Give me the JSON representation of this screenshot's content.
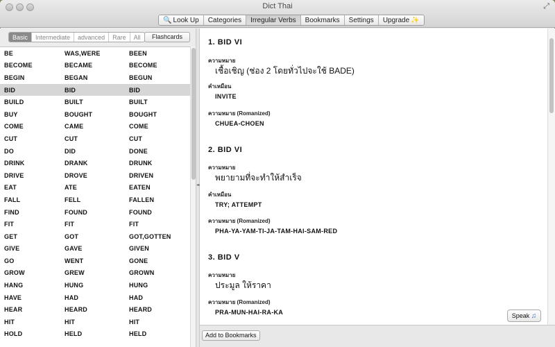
{
  "window": {
    "title": "Dict Thai",
    "fullscreen_glyph": "⤢"
  },
  "toolbar": {
    "items": [
      {
        "label": "Look Up",
        "icon": "🔍"
      },
      {
        "label": "Categories"
      },
      {
        "label": "Irregular Verbs",
        "active": true
      },
      {
        "label": "Bookmarks"
      },
      {
        "label": "Settings"
      },
      {
        "label": "Upgrade",
        "icon": "✨"
      }
    ]
  },
  "filters": {
    "levels": [
      "Basic",
      "Intermediate",
      "advanced",
      "Rare",
      "All"
    ],
    "selected": "Basic",
    "flashcards_label": "Flashcards"
  },
  "verbs": [
    [
      "BE",
      "WAS,WERE",
      "BEEN"
    ],
    [
      "BECOME",
      "BECAME",
      "BECOME"
    ],
    [
      "BEGIN",
      "BEGAN",
      "BEGUN"
    ],
    [
      "BID",
      "BID",
      "BID"
    ],
    [
      "BUILD",
      "BUILT",
      "BUILT"
    ],
    [
      "BUY",
      "BOUGHT",
      "BOUGHT"
    ],
    [
      "COME",
      "CAME",
      "COME"
    ],
    [
      "CUT",
      "CUT",
      "CUT"
    ],
    [
      "DO",
      "DID",
      "DONE"
    ],
    [
      "DRINK",
      "DRANK",
      "DRUNK"
    ],
    [
      "DRIVE",
      "DROVE",
      "DRIVEN"
    ],
    [
      "EAT",
      "ATE",
      "EATEN"
    ],
    [
      "FALL",
      "FELL",
      "FALLEN"
    ],
    [
      "FIND",
      "FOUND",
      "FOUND"
    ],
    [
      "FIT",
      "FIT",
      "FIT"
    ],
    [
      "GET",
      "GOT",
      "GOT,GOTTEN"
    ],
    [
      "GIVE",
      "GAVE",
      "GIVEN"
    ],
    [
      "GO",
      "WENT",
      "GONE"
    ],
    [
      "GROW",
      "GREW",
      "GROWN"
    ],
    [
      "HANG",
      "HUNG",
      "HUNG"
    ],
    [
      "HAVE",
      "HAD",
      "HAD"
    ],
    [
      "HEAR",
      "HEARD",
      "HEARD"
    ],
    [
      "HIT",
      "HIT",
      "HIT"
    ],
    [
      "HOLD",
      "HELD",
      "HELD"
    ]
  ],
  "selected_verb_index": 3,
  "entries": [
    {
      "heading": "1. BID VI",
      "meaning_label": "ความหมาย",
      "meaning": "เชื้อเชิญ (ช่อง 2 โดยทั่วไปจะใช้ BADE)",
      "synonym_label": "คำเหมือน",
      "synonym": "INVITE",
      "romanized_label": "ความหมาย (Romanized)",
      "romanized": "CHUEA-CHOEN"
    },
    {
      "heading": "2. BID VI",
      "meaning_label": "ความหมาย",
      "meaning": "พยายามที่จะทำให้สำเร็จ",
      "synonym_label": "คำเหมือน",
      "synonym": "TRY; ATTEMPT",
      "romanized_label": "ความหมาย (Romanized)",
      "romanized": "PHA-YA-YAM-TI-JA-TAM-HAI-SAM-RED"
    },
    {
      "heading": "3. BID V",
      "meaning_label": "ความหมาย",
      "meaning": "ประมูล  ให้ราคา",
      "romanized_label": "ความหมาย (Romanized)",
      "romanized": "PRA-MUN-HAI-RA-KA"
    }
  ],
  "actions": {
    "speak_label": "Speak",
    "speak_icon": "♫",
    "add_bookmark_label": "Add to Bookmarks"
  }
}
